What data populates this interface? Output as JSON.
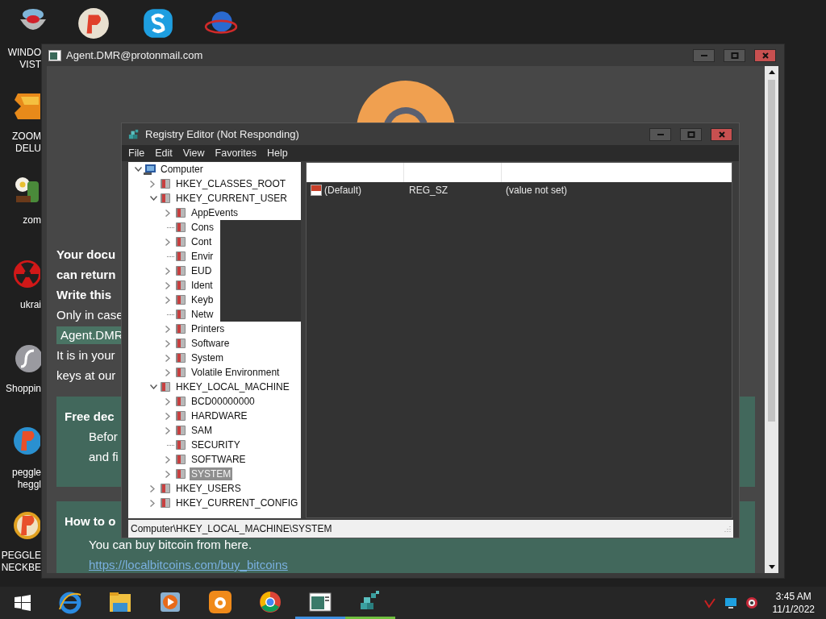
{
  "desktop_icons": [
    {
      "lines": [
        "WINDO",
        "VIST"
      ]
    },
    {
      "lines": [
        "ZOOM",
        "DELU"
      ]
    },
    {
      "lines": [
        "zom"
      ]
    },
    {
      "lines": [
        "ukrai"
      ]
    },
    {
      "lines": [
        "Shoppin"
      ]
    },
    {
      "lines": [
        "peggle",
        "heggl"
      ]
    },
    {
      "lines": [
        "PEGGLE",
        "NECKBE"
      ]
    }
  ],
  "ransom_window": {
    "title": "Agent.DMR@protonmail.com",
    "lines": [
      {
        "text": "Your docu",
        "kind": "bold"
      },
      {
        "text": "can return",
        "kind": "bold"
      },
      {
        "text": "Write this",
        "kind": "bold"
      },
      {
        "text": "Only in case",
        "kind": "plain"
      },
      {
        "text": "Agent.DMR",
        "kind": "highlight"
      },
      {
        "text": "It is in your",
        "kind": "plain"
      },
      {
        "text": "keys at our",
        "kind": "plain"
      }
    ],
    "panels": [
      {
        "heading": "Free dec",
        "lines": [
          "Befor",
          "and fi"
        ]
      },
      {
        "heading": "How to o",
        "lines": [
          "You can buy bitcoin from here."
        ],
        "link": "https://localbitcoins.com/buy_bitcoins"
      }
    ]
  },
  "registry_editor": {
    "title": "Registry Editor (Not Responding)",
    "menu": [
      "File",
      "Edit",
      "View",
      "Favorites",
      "Help"
    ],
    "tree": [
      {
        "label": "Computer",
        "kind": "key",
        "expanded": true,
        "selected": false,
        "children": [
          {
            "label": "HKEY_CLASSES_ROOT",
            "kind": "key",
            "expanded": false,
            "selected": false
          },
          {
            "label": "HKEY_CURRENT_USER",
            "kind": "key",
            "expanded": true,
            "selected": false,
            "children": [
              {
                "label": "AppEvents",
                "kind": "key",
                "expanded": false,
                "selected": false
              },
              {
                "label": "Cons",
                "kind": "leaf",
                "expanded": false,
                "selected": false
              },
              {
                "label": "Cont",
                "kind": "key",
                "expanded": false,
                "selected": false
              },
              {
                "label": "Envir",
                "kind": "leaf",
                "expanded": false,
                "selected": false
              },
              {
                "label": "EUD",
                "kind": "key",
                "expanded": false,
                "selected": false
              },
              {
                "label": "Ident",
                "kind": "key",
                "expanded": false,
                "selected": false
              },
              {
                "label": "Keyb",
                "kind": "key",
                "expanded": false,
                "selected": false
              },
              {
                "label": "Netw",
                "kind": "leaf",
                "expanded": false,
                "selected": false
              },
              {
                "label": "Printers",
                "kind": "key",
                "expanded": false,
                "selected": false
              },
              {
                "label": "Software",
                "kind": "key",
                "expanded": false,
                "selected": false
              },
              {
                "label": "System",
                "kind": "key",
                "expanded": false,
                "selected": false
              },
              {
                "label": "Volatile Environment",
                "kind": "key",
                "expanded": false,
                "selected": false
              }
            ]
          },
          {
            "label": "HKEY_LOCAL_MACHINE",
            "kind": "key",
            "expanded": true,
            "selected": false,
            "children": [
              {
                "label": "BCD00000000",
                "kind": "key",
                "expanded": false,
                "selected": false
              },
              {
                "label": "HARDWARE",
                "kind": "key",
                "expanded": false,
                "selected": false
              },
              {
                "label": "SAM",
                "kind": "key",
                "expanded": false,
                "selected": false
              },
              {
                "label": "SECURITY",
                "kind": "leaf",
                "expanded": false,
                "selected": false
              },
              {
                "label": "SOFTWARE",
                "kind": "key",
                "expanded": false,
                "selected": false
              },
              {
                "label": "SYSTEM",
                "kind": "key",
                "expanded": false,
                "selected": true
              }
            ]
          },
          {
            "label": "HKEY_USERS",
            "kind": "key",
            "expanded": false,
            "selected": false
          },
          {
            "label": "HKEY_CURRENT_CONFIG",
            "kind": "key",
            "expanded": false,
            "selected": false
          }
        ]
      }
    ],
    "values": [
      {
        "name": "(Default)",
        "type": "REG_SZ",
        "data": "(value not set)"
      }
    ],
    "status_bar": "Computer\\HKEY_LOCAL_MACHINE\\SYSTEM"
  },
  "taskbar": {
    "apps": [
      {
        "running": false
      },
      {
        "running": false
      },
      {
        "running": false
      },
      {
        "running": false
      },
      {
        "running": false
      },
      {
        "running": true,
        "color": "#3f8fe0"
      },
      {
        "running": true,
        "color": "#6fbf3f"
      }
    ],
    "clock": {
      "time": "3:45 AM",
      "date": "11/1/2022"
    }
  }
}
